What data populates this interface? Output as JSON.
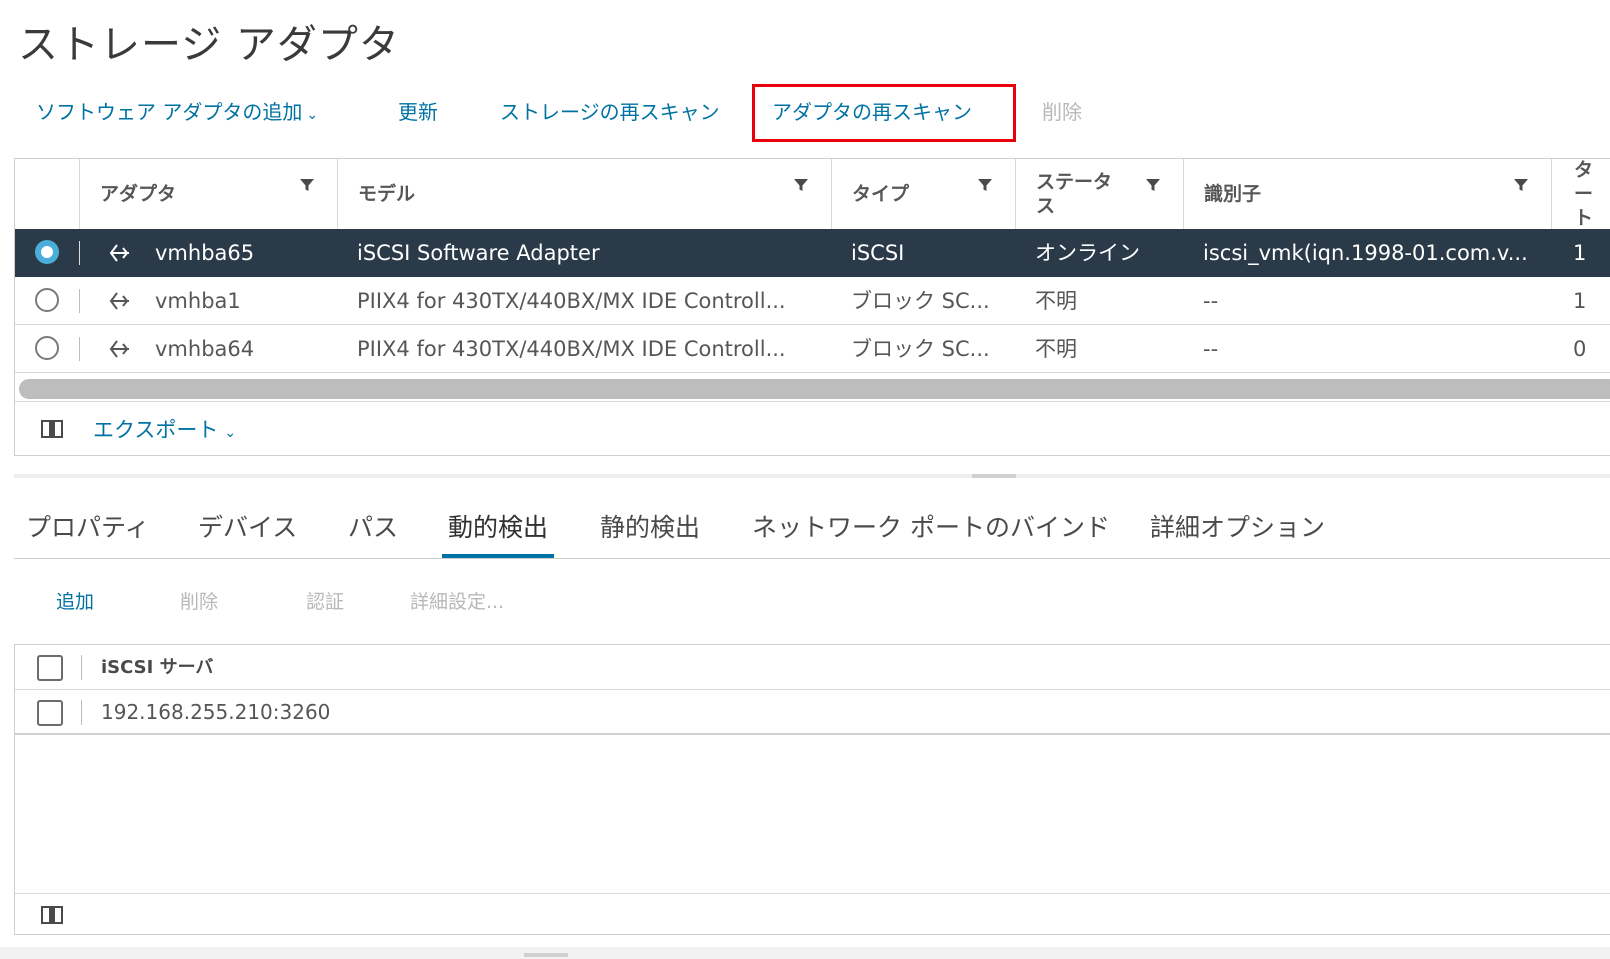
{
  "page": {
    "title": "ストレージ アダプタ"
  },
  "toolbar": {
    "add_software_adapter": "ソフトウェア アダプタの追加",
    "refresh": "更新",
    "rescan_storage": "ストレージの再スキャン",
    "rescan_adapter": "アダプタの再スキャン",
    "delete": "削除"
  },
  "colors": {
    "accent": "#0072a3",
    "selected_row": "#2b3a48",
    "highlight_box": "#e8000b",
    "radio_checked": "#49afd9"
  },
  "adapter_grid": {
    "columns": [
      "アダプタ",
      "モデル",
      "タイプ",
      "ステータス",
      "識別子",
      "ター ト"
    ],
    "rows": [
      {
        "adapter": "vmhba65",
        "model": "iSCSI Software Adapter",
        "type": "iSCSI",
        "status": "オンライン",
        "identifier": "iscsi_vmk(iqn.1998-01.com.v...",
        "targets": "1",
        "selected": true
      },
      {
        "adapter": "vmhba1",
        "model": "PIIX4 for 430TX/440BX/MX IDE Controll...",
        "type": "ブロック SC...",
        "status": "不明",
        "identifier": "--",
        "targets": "1",
        "selected": false
      },
      {
        "adapter": "vmhba64",
        "model": "PIIX4 for 430TX/440BX/MX IDE Controll...",
        "type": "ブロック SC...",
        "status": "不明",
        "identifier": "--",
        "targets": "0",
        "selected": false
      }
    ],
    "export_label": "エクスポート"
  },
  "tabs": [
    {
      "label": "プロパティ",
      "active": false
    },
    {
      "label": "デバイス",
      "active": false
    },
    {
      "label": "パス",
      "active": false
    },
    {
      "label": "動的検出",
      "active": true
    },
    {
      "label": "静的検出",
      "active": false
    },
    {
      "label": "ネットワーク ポートのバインド",
      "active": false
    },
    {
      "label": "詳細オプション",
      "active": false
    }
  ],
  "discovery_toolbar": {
    "add": "追加",
    "delete": "削除",
    "auth": "認証",
    "advanced": "詳細設定..."
  },
  "discovery_grid": {
    "header": "iSCSI サーバ",
    "rows": [
      "192.168.255.210:3260"
    ]
  }
}
